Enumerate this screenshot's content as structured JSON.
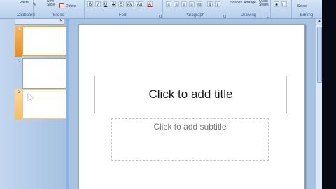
{
  "ribbon": {
    "groups": {
      "clipboard": "Clipboard",
      "slides": "Slides",
      "font": "Font",
      "paragraph": "Paragraph",
      "drawing": "Drawing",
      "editing": "Editing"
    },
    "buttons": {
      "paste": "Paste",
      "new_slide": "New Slide",
      "delete": "Delete",
      "shapes": "Shapes",
      "arrange": "Arrange",
      "quick_styles": "Quick Styles",
      "select": "Select"
    }
  },
  "slides": [
    {
      "number": "1",
      "state": "selected"
    },
    {
      "number": "2",
      "state": "normal"
    },
    {
      "number": "3",
      "state": "hover"
    }
  ],
  "slide": {
    "title_placeholder": "Click to add title",
    "subtitle_placeholder": "Click to add subtitle"
  },
  "icons": {
    "pane_close": "close-icon",
    "scroll_up": "chevron-up-icon"
  }
}
